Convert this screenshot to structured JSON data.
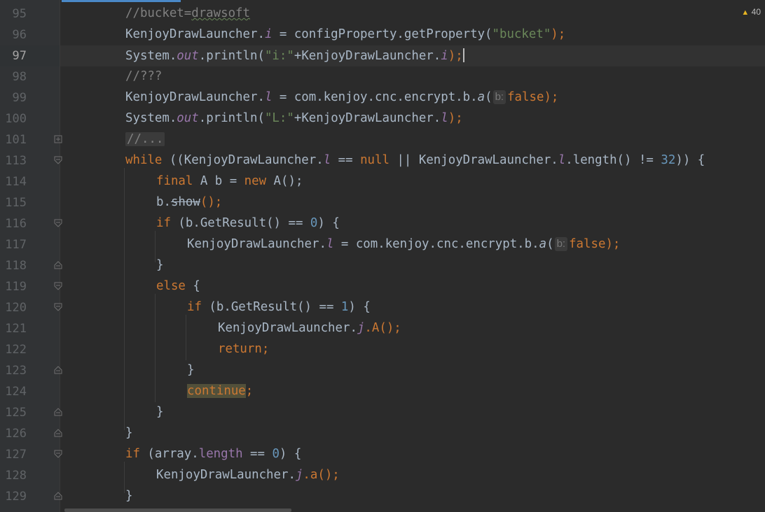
{
  "editor": {
    "warnings": {
      "icon": "warning-triangle-icon",
      "count": "40"
    },
    "current_line": "97"
  },
  "lines": [
    {
      "n": "95",
      "fold": "none"
    },
    {
      "n": "96",
      "fold": "none"
    },
    {
      "n": "97",
      "fold": "none"
    },
    {
      "n": "98",
      "fold": "none"
    },
    {
      "n": "99",
      "fold": "none"
    },
    {
      "n": "100",
      "fold": "none"
    },
    {
      "n": "101",
      "fold": "plus"
    },
    {
      "n": "113",
      "fold": "open"
    },
    {
      "n": "114",
      "fold": "none"
    },
    {
      "n": "115",
      "fold": "none"
    },
    {
      "n": "116",
      "fold": "open"
    },
    {
      "n": "117",
      "fold": "none"
    },
    {
      "n": "118",
      "fold": "end"
    },
    {
      "n": "119",
      "fold": "open"
    },
    {
      "n": "120",
      "fold": "open"
    },
    {
      "n": "121",
      "fold": "none"
    },
    {
      "n": "122",
      "fold": "none"
    },
    {
      "n": "123",
      "fold": "end"
    },
    {
      "n": "124",
      "fold": "none"
    },
    {
      "n": "125",
      "fold": "end"
    },
    {
      "n": "126",
      "fold": "end"
    },
    {
      "n": "127",
      "fold": "open"
    },
    {
      "n": "128",
      "fold": "none"
    },
    {
      "n": "129",
      "fold": "end"
    }
  ],
  "code": {
    "l95": {
      "comment": "//bucket=",
      "squiggle": "drawsoft"
    },
    "l96": {
      "cls": "KenjoyDrawLauncher.",
      "field": "i",
      "mid": " = configProperty.getProperty(",
      "str": "\"bucket\"",
      "end": ");"
    },
    "l97": {
      "a": "System.",
      "field": "out",
      "b": ".println(",
      "str": "\"i:\"",
      "c": "+KenjoyDrawLauncher.",
      "field2": "i",
      "end": ");"
    },
    "l98": {
      "comment": "//???"
    },
    "l99": {
      "cls": "KenjoyDrawLauncher.",
      "field": "l",
      "mid": " = com.kenjoy.cnc.encrypt.b.",
      "method": "a",
      "paren": "(",
      "hint": "b:",
      "kw": "false",
      "end": ");"
    },
    "l100": {
      "a": "System.",
      "field": "out",
      "b": ".println(",
      "str": "\"L:\"",
      "c": "+KenjoyDrawLauncher.",
      "field2": "l",
      "end": ");"
    },
    "l101": {
      "comment": "//..."
    },
    "l113": {
      "kw": "while",
      "a": " ((KenjoyDrawLauncher.",
      "f1": "l",
      "b": " == ",
      "nul": "null",
      "c": " || KenjoyDrawLauncher.",
      "f2": "l",
      "d": ".length() != ",
      "num": "32",
      "e": ")) {"
    },
    "l114": {
      "kw1": "final",
      "a": " A b = ",
      "kw2": "new",
      "b": " A();"
    },
    "l115": {
      "a": "b.",
      "strike": "show",
      "b": "();"
    },
    "l116": {
      "kw": "if",
      "a": " (b.GetResult() == ",
      "num": "0",
      "b": ") {"
    },
    "l117": {
      "cls": "KenjoyDrawLauncher.",
      "field": "l",
      "mid": " = com.kenjoy.cnc.encrypt.b.",
      "method": "a",
      "paren": "(",
      "hint": "b:",
      "kw": "false",
      "end": ");"
    },
    "l118": {
      "a": "}"
    },
    "l119": {
      "kw": "else",
      "a": " {"
    },
    "l120": {
      "kw": "if",
      "a": " (b.GetResult() == ",
      "num": "1",
      "b": ") {"
    },
    "l121": {
      "a": "KenjoyDrawLauncher.",
      "field": "j",
      "b": ".A();"
    },
    "l122": {
      "kw": "return",
      "a": ";"
    },
    "l123": {
      "a": "}"
    },
    "l124": {
      "kw": "continue",
      "a": ";"
    },
    "l125": {
      "a": "}"
    },
    "l126": {
      "a": "}"
    },
    "l127": {
      "kw": "if",
      "a": " (array.",
      "field": "length",
      "b": " == ",
      "num": "0",
      "c": ") {"
    },
    "l128": {
      "a": "KenjoyDrawLauncher.",
      "field": "j",
      "b": ".a();"
    },
    "l129": {
      "a": "}"
    }
  }
}
